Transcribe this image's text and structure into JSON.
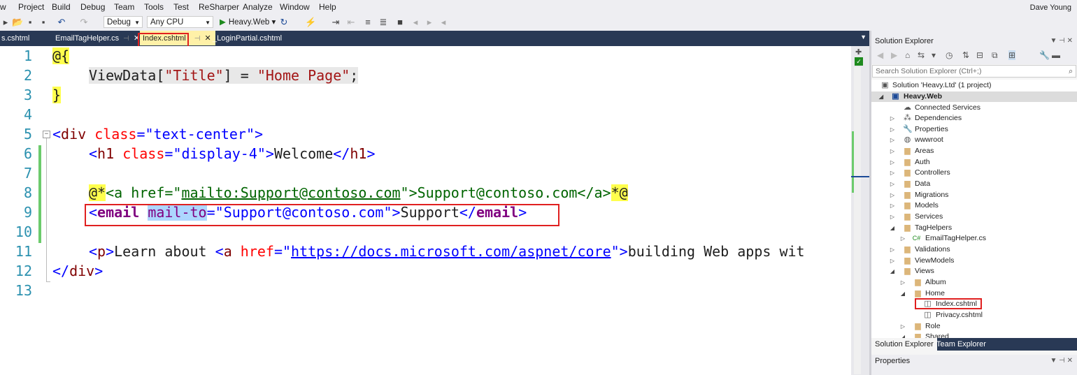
{
  "menu": {
    "items": [
      "w",
      "Project",
      "Build",
      "Debug",
      "Team",
      "Tools",
      "Test",
      "ReSharper",
      "Analyze",
      "Window",
      "Help"
    ],
    "user": "Dave Young"
  },
  "toolbar": {
    "configuration": "Debug",
    "platform": "Any CPU",
    "start_label": "Heavy.Web"
  },
  "tabs": [
    {
      "label": "s.cshtml"
    },
    {
      "label": "EmailTagHelper.cs"
    },
    {
      "label": "Index.cshtml"
    },
    {
      "label": "_LoginPartial.cshtml"
    }
  ],
  "editor": {
    "line_numbers": [
      "1",
      "2",
      "3",
      "4",
      "5",
      "6",
      "7",
      "8",
      "9",
      "10",
      "11",
      "12",
      "13"
    ],
    "code": {
      "l1_razor": "@{",
      "l2_a": "ViewData[",
      "l2_str": "\"Title\"",
      "l2_b": "] = ",
      "l2_str2": "\"Home Page\"",
      "l2_c": ";",
      "l3_razor": "}",
      "l5_lt": "<",
      "l5_tag": "div",
      "l5_attr": "class",
      "l5_eq": "=",
      "l5_val": "\"text-center\"",
      "l5_gt": ">",
      "l6_lt": "<",
      "l6_tag": "h1",
      "l6_attr": "class",
      "l6_eq": "=",
      "l6_val": "\"display-4\"",
      "l6_gt": ">",
      "l6_text": "Welcome",
      "l6_close": "</",
      "l6_ctag": "h1",
      "l6_cgt": ">",
      "l8_razor1": "@*",
      "l8_comment_a": "<a href=\"",
      "l8_link": "mailto:Support@contoso.com",
      "l8_comment_b": "\">Support@contoso.com</a>",
      "l8_razor2": "*@",
      "l9_lt": "<",
      "l9_tag": "email",
      "l9_attr_sel": "mail-to",
      "l9_eq": "=",
      "l9_val": "\"Support@contoso.com\"",
      "l9_gt": ">",
      "l9_text": "Support",
      "l9_close": "</",
      "l9_ctag": "email",
      "l9_cgt": ">",
      "l11_lt": "<",
      "l11_tag": "p",
      "l11_gt": ">",
      "l11_text": "Learn about ",
      "l11_alt": "<",
      "l11_atag": "a",
      "l11_attr": "href",
      "l11_eq": "=",
      "l11_q1": "\"",
      "l11_link": "https://docs.microsoft.com/aspnet/core",
      "l11_q2": "\"",
      "l11_agt": ">",
      "l11_text2": "building Web apps wit",
      "l12_close": "</",
      "l12_tag": "div",
      "l12_gt": ">"
    }
  },
  "solution_explorer": {
    "title": "Solution Explorer",
    "search_placeholder": "Search Solution Explorer (Ctrl+;)",
    "tree": [
      {
        "label": "Solution 'Heavy.Ltd' (1 project)",
        "depth": 0,
        "icon": "solution-icon"
      },
      {
        "label": "Heavy.Web",
        "depth": 1,
        "icon": "project-icon",
        "selected": true
      },
      {
        "label": "Connected Services",
        "depth": 2,
        "icon": "cloud-icon"
      },
      {
        "label": "Dependencies",
        "depth": 2,
        "icon": "dependencies-icon"
      },
      {
        "label": "Properties",
        "depth": 2,
        "icon": "wrench-icon"
      },
      {
        "label": "wwwroot",
        "depth": 2,
        "icon": "globe-icon"
      },
      {
        "label": "Areas",
        "depth": 2,
        "icon": "folder-icon"
      },
      {
        "label": "Auth",
        "depth": 2,
        "icon": "folder-icon"
      },
      {
        "label": "Controllers",
        "depth": 2,
        "icon": "folder-icon"
      },
      {
        "label": "Data",
        "depth": 2,
        "icon": "folder-icon"
      },
      {
        "label": "Migrations",
        "depth": 2,
        "icon": "folder-icon"
      },
      {
        "label": "Models",
        "depth": 2,
        "icon": "folder-icon"
      },
      {
        "label": "Services",
        "depth": 2,
        "icon": "folder-icon"
      },
      {
        "label": "TagHelpers",
        "depth": 2,
        "icon": "folder-icon"
      },
      {
        "label": "EmailTagHelper.cs",
        "depth": 3,
        "icon": "csharp-file-icon"
      },
      {
        "label": "Validations",
        "depth": 2,
        "icon": "folder-icon"
      },
      {
        "label": "ViewModels",
        "depth": 2,
        "icon": "folder-icon"
      },
      {
        "label": "Views",
        "depth": 2,
        "icon": "folder-icon"
      },
      {
        "label": "Album",
        "depth": 3,
        "icon": "folder-icon"
      },
      {
        "label": "Home",
        "depth": 3,
        "icon": "folder-icon"
      },
      {
        "label": "Index.cshtml",
        "depth": 4,
        "icon": "razor-file-icon"
      },
      {
        "label": "Privacy.cshtml",
        "depth": 4,
        "icon": "razor-file-icon"
      },
      {
        "label": "Role",
        "depth": 3,
        "icon": "folder-icon"
      },
      {
        "label": "Shared",
        "depth": 3,
        "icon": "folder-icon"
      }
    ],
    "bottom_tabs": [
      "Solution Explorer",
      "Team Explorer"
    ]
  },
  "properties": {
    "title": "Properties"
  },
  "colors": {
    "tab_bar": "#293955",
    "active_tab": "#fff1a8",
    "highlight_box": "#e02020",
    "line_numbers": "#2b91af"
  }
}
